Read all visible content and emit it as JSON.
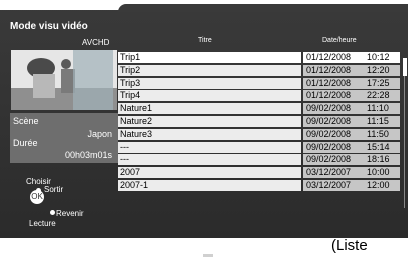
{
  "panel": {
    "mode_title": "Mode visu vidéo",
    "format_badge": "AVCHD",
    "scene_label": "Scène",
    "scene_value": "Japon",
    "duration_label": "Durée",
    "duration_value": "00h03m01s"
  },
  "nav": {
    "choisir": "Choisir",
    "sortir": "Sortir",
    "revenir": "Revenir",
    "lecture": "Lecture",
    "ok": "OK"
  },
  "table": {
    "col_title": "Titre",
    "col_date": "Date/heure",
    "selected_index": 0,
    "rows": [
      {
        "title": "Trip1",
        "date": "01/12/2008",
        "time": "10:12"
      },
      {
        "title": "Trip2",
        "date": "01/12/2008",
        "time": "12:20"
      },
      {
        "title": "Trip3",
        "date": "01/12/2008",
        "time": "17:25"
      },
      {
        "title": "Trip4",
        "date": "01/12/2008",
        "time": "22:28"
      },
      {
        "title": "Nature1",
        "date": "09/02/2008",
        "time": "11:10"
      },
      {
        "title": "Nature2",
        "date": "09/02/2008",
        "time": "11:15"
      },
      {
        "title": "Nature3",
        "date": "09/02/2008",
        "time": "11:50"
      },
      {
        "title": "---",
        "date": "09/02/2008",
        "time": "15:14"
      },
      {
        "title": "---",
        "date": "09/02/2008",
        "time": "18:16"
      },
      {
        "title": "2007",
        "date": "03/12/2007",
        "time": "10:00"
      },
      {
        "title": "2007-1",
        "date": "03/12/2007",
        "time": "12:00"
      }
    ]
  },
  "caption": "(Liste"
}
